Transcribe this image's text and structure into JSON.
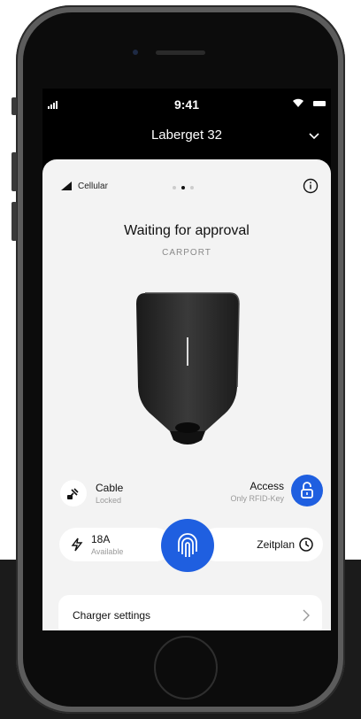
{
  "statusbar": {
    "time": "9:41"
  },
  "header": {
    "title": "Laberget 32"
  },
  "card": {
    "connection": "Cellular",
    "page_count": 3,
    "active_page": 2,
    "status_title": "Waiting for approval",
    "location": "CARPORT"
  },
  "cable": {
    "label": "Cable",
    "status": "Locked"
  },
  "access": {
    "label": "Access",
    "status": "Only RFID-Key"
  },
  "power": {
    "value": "18A",
    "status": "Available"
  },
  "schedule": {
    "label": "Zeitplan"
  },
  "settings": {
    "label": "Charger settings"
  },
  "colors": {
    "accent": "#1f5fe0",
    "card_bg": "#f3f3f3",
    "screen_bg": "#000000"
  },
  "icons": [
    "signal-icon",
    "wifi-icon",
    "battery-icon",
    "chevron-down-icon",
    "cellular-icon",
    "info-icon",
    "cable-lock-icon",
    "lock-open-icon",
    "lightning-icon",
    "fingerprint-icon",
    "clock-icon",
    "chevron-right-icon"
  ]
}
